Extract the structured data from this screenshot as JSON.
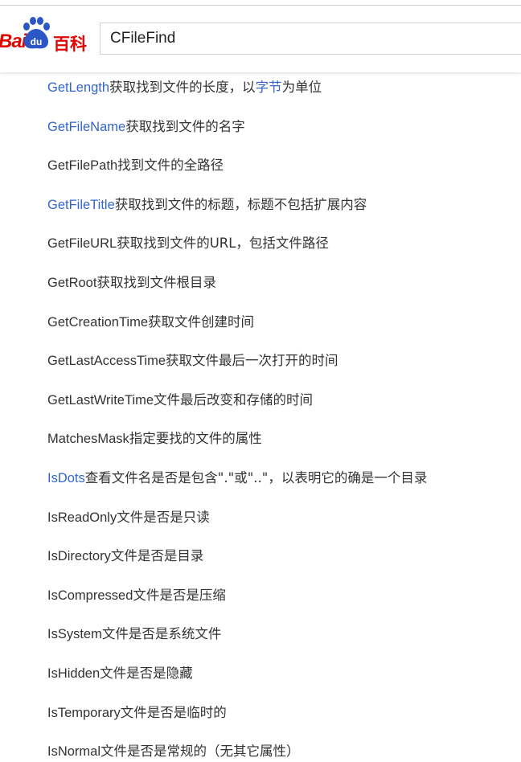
{
  "header": {
    "logo_left": "Bai",
    "logo_paw": "du",
    "logo_right": "百科",
    "search_value": "CFileFind"
  },
  "colors": {
    "link": "#3366cc",
    "text": "#333333",
    "brand": "#e10602"
  },
  "items": [
    {
      "name": "GetLength",
      "name_link": true,
      "desc": "获取找到文件的长度，以",
      "desc_link": "字节",
      "desc_after": "为单位"
    },
    {
      "name": "GetFileName",
      "name_link": true,
      "desc": "获取找到文件的名字"
    },
    {
      "name": "GetFilePath",
      "name_link": false,
      "desc": "找到文件的全路径"
    },
    {
      "name": "GetFileTitle",
      "name_link": true,
      "desc": "获取找到文件的标题，标题不包括扩展内容"
    },
    {
      "name": "GetFileURL",
      "name_link": false,
      "desc": "获取找到文件的URL，包括文件路径"
    },
    {
      "name": "GetRoot",
      "name_link": false,
      "desc": "获取找到文件根目录"
    },
    {
      "name": "GetCreationTime",
      "name_link": false,
      "desc": "获取文件创建时间"
    },
    {
      "name": "GetLastAccessTime",
      "name_link": false,
      "desc": "获取文件最后一次打开的时间"
    },
    {
      "name": "GetLastWriteTime",
      "name_link": false,
      "desc": "文件最后改变和存储的时间"
    },
    {
      "name": "MatchesMask",
      "name_link": false,
      "desc": "指定要找的文件的属性"
    },
    {
      "name": "IsDots",
      "name_link": true,
      "desc": "查看文件名是否是包含\".\"或\"..\"，以表明它的确是一个目录"
    },
    {
      "name": "IsReadOnly",
      "name_link": false,
      "desc": "文件是否是只读"
    },
    {
      "name": "IsDirectory",
      "name_link": false,
      "desc": "文件是否是目录"
    },
    {
      "name": "IsCompressed",
      "name_link": false,
      "desc": "文件是否是压缩"
    },
    {
      "name": "IsSystem",
      "name_link": false,
      "desc": "文件是否是系统文件"
    },
    {
      "name": "IsHidden",
      "name_link": false,
      "desc": "文件是否是隐藏"
    },
    {
      "name": "IsTemporary",
      "name_link": false,
      "desc": "文件是否是临时的"
    },
    {
      "name": "IsNormal",
      "name_link": false,
      "desc": "文件是否是常规的（无其它属性）"
    }
  ]
}
